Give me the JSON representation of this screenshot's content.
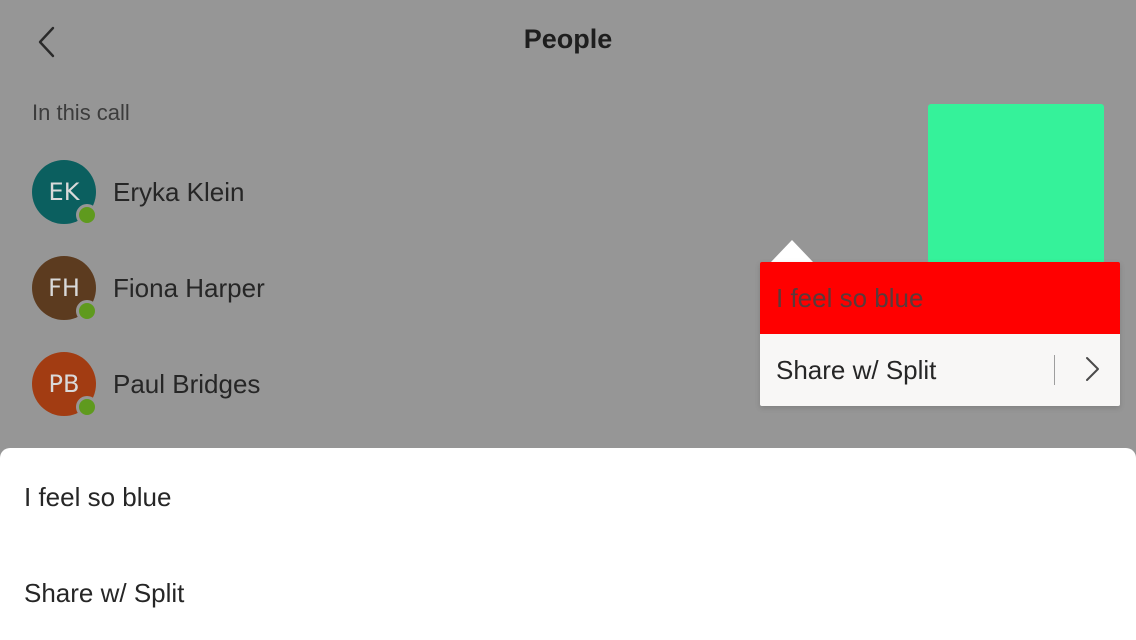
{
  "header": {
    "title": "People",
    "back_icon": "chevron-left-icon"
  },
  "section": {
    "label": "In this call"
  },
  "people": [
    {
      "initials": "EK",
      "name": "Eryka Klein",
      "avatar_color": "#0b5f5f",
      "status": "available",
      "status_color": "#5f9a1e"
    },
    {
      "initials": "FH",
      "name": "Fiona Harper",
      "avatar_color": "#5c3b1f",
      "status": "available",
      "status_color": "#5f9a1e"
    },
    {
      "initials": "PB",
      "name": "Paul Bridges",
      "avatar_color": "#a23c12",
      "status": "available",
      "status_color": "#5f9a1e"
    }
  ],
  "video_tile": {
    "color": "#35f29a"
  },
  "popover": {
    "primary_label": "I feel so blue",
    "primary_color": "#ff0000",
    "secondary_label": "Share w/ Split",
    "secondary_color": "#f8f7f6",
    "chevron_icon": "chevron-right-icon"
  },
  "sheet": {
    "items": [
      {
        "label": "I feel so blue"
      },
      {
        "label": "Share w/ Split"
      }
    ]
  },
  "colors": {
    "overlay_background": "#969696",
    "sheet_background": "#ffffff"
  }
}
